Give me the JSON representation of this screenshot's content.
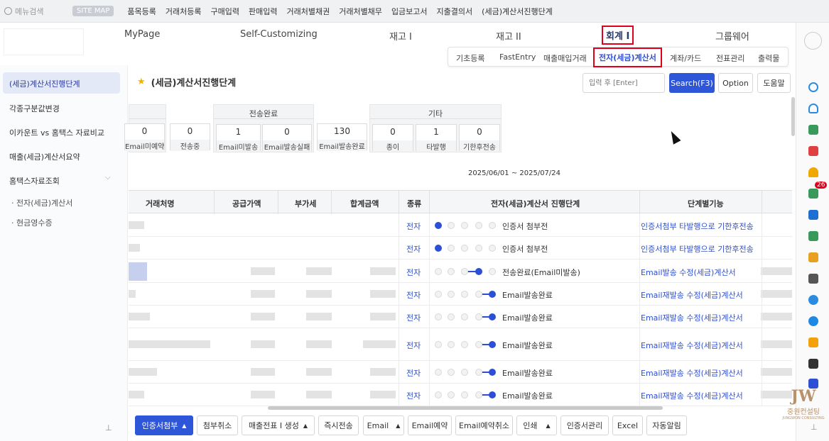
{
  "topbar": {
    "search_placeholder": "메뉴검색",
    "sitemap": "SITE MAP",
    "quick_menu": [
      "품목등록",
      "거래처등록",
      "구매입력",
      "판매입력",
      "거래처별채권",
      "거래처별채무",
      "입금보고서",
      "지출결의서",
      "(세금)계산서진행단계"
    ]
  },
  "main_menu": [
    "MyPage",
    "Self-Customizing",
    "재고 I",
    "재고 II",
    "회계 I",
    "그룹웨어"
  ],
  "sub_menu": [
    "기초등록",
    "FastEntry",
    "매출매입거래",
    "전자(세금)계산서",
    "계좌/카드",
    "전표관리",
    "출력물"
  ],
  "sidebar": {
    "items": [
      "(세금)계산서진행단계",
      "각종구분값변경",
      "이카운트 vs 홈택스 자료비교",
      "매출(세금)계산서요약",
      "홈택스자료조회"
    ],
    "subitems": [
      "전자(세금)계산서",
      "현금영수증"
    ]
  },
  "page": {
    "title": "(세금)계산서진행단계",
    "search_placeholder": "입력 후 [Enter]",
    "search_btn": "Search(F3)",
    "option_btn": "Option",
    "help_btn": "도움말",
    "date_range": "2025/06/01 ~ 2025/07/24"
  },
  "summary": {
    "left_cells": [
      {
        "value": "0",
        "label": "Email미예약"
      },
      {
        "value": "0",
        "label": "전송중"
      }
    ],
    "group1": {
      "title": "전송완료",
      "cells": [
        {
          "value": "1",
          "label": "Email미발송"
        },
        {
          "value": "0",
          "label": "Email발송실패"
        }
      ]
    },
    "solo": {
      "value": "130",
      "label": "Email발송완료"
    },
    "group2": {
      "title": "기타",
      "cells": [
        {
          "value": "0",
          "label": "종이"
        },
        {
          "value": "1",
          "label": "타발행"
        },
        {
          "value": "0",
          "label": "기한후전송"
        }
      ]
    }
  },
  "table": {
    "headers": [
      "거래처명",
      "공급가액",
      "부가세",
      "합계금액",
      "종류",
      "전자(세금)계산서 진행단계",
      "단계별기능"
    ],
    "rows": [
      {
        "kind": "전자",
        "stage": "인증서 첨부전",
        "func": "인증서첨부 타발행으로 기한후전송",
        "progress": 1
      },
      {
        "kind": "전자",
        "stage": "인증서 첨부전",
        "func": "인증서첨부 타발행으로 기한후전송",
        "progress": 1
      },
      {
        "kind": "전자",
        "stage": "전송완료(Email미발송)",
        "func": "Email발송 수정(세금)계산서",
        "progress": 4
      },
      {
        "kind": "전자",
        "stage": "Email발송완료",
        "func": "Email재발송 수정(세금)계산서",
        "progress": 5
      },
      {
        "kind": "전자",
        "stage": "Email발송완료",
        "func": "Email재발송 수정(세금)계산서",
        "progress": 5
      },
      {
        "kind": "전자",
        "stage": "Email발송완료",
        "func": "Email재발송 수정(세금)계산서",
        "progress": 5
      },
      {
        "kind": "전자",
        "stage": "Email발송완료",
        "func": "Email재발송 수정(세금)계산서",
        "progress": 5
      },
      {
        "kind": "전자",
        "stage": "Email발송완료",
        "func": "Email재발송 수정(세금)계산서",
        "progress": 5
      }
    ]
  },
  "bottom_buttons": [
    "인증서첨부",
    "첨부취소",
    "매출전표 I 생성",
    "즉시전송",
    "Email",
    "Email예약",
    "Email예약취소",
    "인쇄",
    "인증서관리",
    "Excel",
    "자동알림"
  ],
  "right_badge": "26",
  "watermark": {
    "title": "중원컨설팅",
    "subtitle": "JUNGWON CONSULTING"
  },
  "colors": {
    "accent": "#2e56d9",
    "highlight": "#e0001b",
    "link": "#2d4fd6"
  }
}
